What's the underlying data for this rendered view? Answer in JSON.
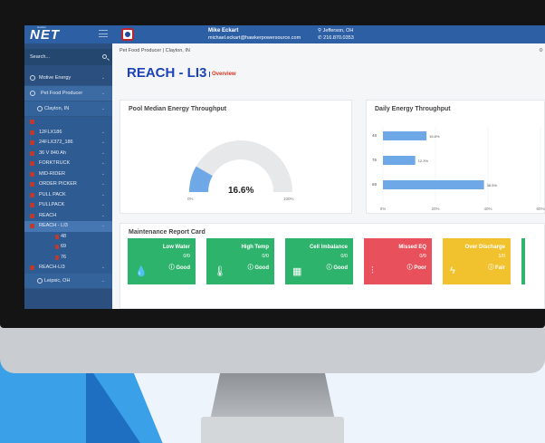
{
  "topbar": {
    "logo": "NET",
    "logo_sup": "Hawker",
    "user_name": "Mike Eckart",
    "user_email": "michael.eckart@hawkerpowersource.com",
    "location": "Jefferson, OH",
    "phone": "216.870.0353"
  },
  "sidebar": {
    "search_placeholder": "Search...",
    "items": [
      {
        "label": "Motive Energy"
      },
      {
        "label": "Pet Food Producer"
      },
      {
        "label": "Clayton, IN"
      },
      {
        "label": ""
      },
      {
        "label": "12FLX186"
      },
      {
        "label": "24FLX372_186"
      },
      {
        "label": "36 V 840 Ah"
      },
      {
        "label": "FORKTRUCK"
      },
      {
        "label": "MID-RIDER"
      },
      {
        "label": "ORDER PICKER"
      },
      {
        "label": "PULL PACK"
      },
      {
        "label": "PULLPACK"
      },
      {
        "label": "REACH"
      },
      {
        "label": "REACH - LI3"
      },
      {
        "label": "48"
      },
      {
        "label": "69"
      },
      {
        "label": "76"
      },
      {
        "label": "REACH-LI3"
      },
      {
        "label": "Leipsic, OH"
      }
    ]
  },
  "main": {
    "breadcrumb": "Pet Food Producer | Clayton, IN",
    "page_title": "REACH - LI3",
    "page_subtitle": "Overview",
    "gauge_card": {
      "title": "Pool Median Energy Throughput",
      "value_label": "16.6%",
      "value": 16.6,
      "min_label": "0%",
      "max_label": "100%"
    },
    "bar_card": {
      "title": "Daily Energy Throughput"
    },
    "report_card": {
      "title": "Maintenance Report Card",
      "tiles": [
        {
          "title": "Low Water",
          "count": "0/0",
          "status": "Good",
          "color": "#2db36b",
          "icon": "water-drop-icon"
        },
        {
          "title": "High Temp",
          "count": "0/0",
          "status": "Good",
          "color": "#2db36b",
          "icon": "thermometer-icon"
        },
        {
          "title": "Cell Imbalance",
          "count": "0/0",
          "status": "Good",
          "color": "#2db36b",
          "icon": "battery-cells-icon"
        },
        {
          "title": "Missed EQ",
          "count": "0/9",
          "status": "Poor",
          "color": "#e8505b",
          "icon": "sliders-icon"
        },
        {
          "title": "Over Discharge",
          "count": "1/0",
          "status": "Fair",
          "color": "#f2c12e",
          "icon": "lightning-icon"
        }
      ]
    }
  },
  "chart_data": {
    "type": "bar",
    "title": "Daily Energy Throughput",
    "orientation": "horizontal",
    "categories": [
      "48",
      "76",
      "69"
    ],
    "values": [
      16.6,
      12.3,
      38.5
    ],
    "data_labels": [
      "16.6%",
      "12.3%",
      "38.5%"
    ],
    "x_ticks": [
      "0%",
      "20%",
      "40%",
      "60%"
    ],
    "xlim": [
      0,
      60
    ],
    "grid": true,
    "color": "#6fa8e6"
  }
}
